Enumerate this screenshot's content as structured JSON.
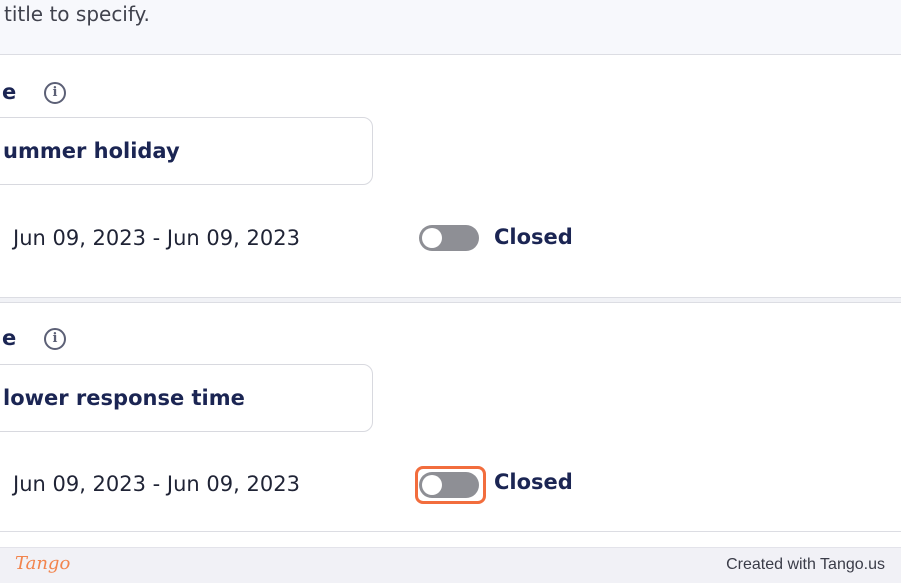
{
  "hint_text": "title to specify.",
  "entries": [
    {
      "label": "e",
      "title_value": "ummer holiday",
      "date_range": "Jun 09, 2023 - Jun 09, 2023",
      "toggle_status": "Closed",
      "toggle_on": false
    },
    {
      "label": "e",
      "title_value": "lower response time",
      "date_range": "Jun 09, 2023 - Jun 09, 2023",
      "toggle_status": "Closed",
      "toggle_on": false,
      "toggle_highlighted": true
    }
  ],
  "icons": {
    "info": "info-circle-icon",
    "info_glyph": "i"
  },
  "colors": {
    "highlight": "#f26d3d",
    "toggle_off": "#8e8f95",
    "label_text": "#1b2553",
    "brand_logo": "#f2844d"
  },
  "footer": {
    "logo": "Tango",
    "credit": "Created with Tango.us"
  }
}
